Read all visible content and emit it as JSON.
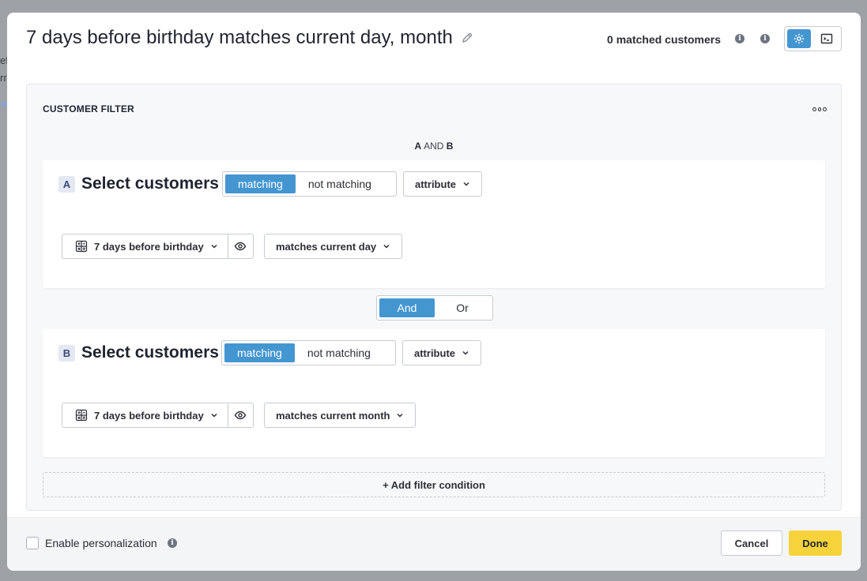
{
  "background": {
    "text_fragments": [
      "ef",
      "rr"
    ]
  },
  "modal": {
    "title": "7 days before birthday matches current day, month",
    "matched_customers": "0 matched customers",
    "info_icon_glyph": "i",
    "mode_toggle": {
      "active": "visual-builder-icon",
      "inactive": "code-terminal-icon"
    }
  },
  "filter": {
    "panel_title": "CUSTOMER FILTER",
    "logic": {
      "left": "A",
      "op": "AND",
      "right": "B"
    },
    "groups": [
      {
        "letter": "A",
        "title": "Select customers",
        "segment": {
          "options": [
            "matching",
            "not matching"
          ],
          "selected": "matching"
        },
        "type_dropdown": "attribute",
        "attribute": "7 days before birthday",
        "condition": "matches current day"
      },
      {
        "letter": "B",
        "title": "Select customers",
        "segment": {
          "options": [
            "matching",
            "not matching"
          ],
          "selected": "matching"
        },
        "type_dropdown": "attribute",
        "attribute": "7 days before birthday",
        "condition": "matches current month"
      }
    ],
    "joiner": {
      "options": [
        "And",
        "Or"
      ],
      "selected": "And"
    },
    "add_condition": "+ Add filter condition"
  },
  "footer": {
    "personalization_label": "Enable personalization",
    "personalization_checked": false,
    "cancel": "Cancel",
    "done": "Done"
  },
  "colors": {
    "accent": "#4496d1",
    "done_button": "#f7d33b"
  }
}
